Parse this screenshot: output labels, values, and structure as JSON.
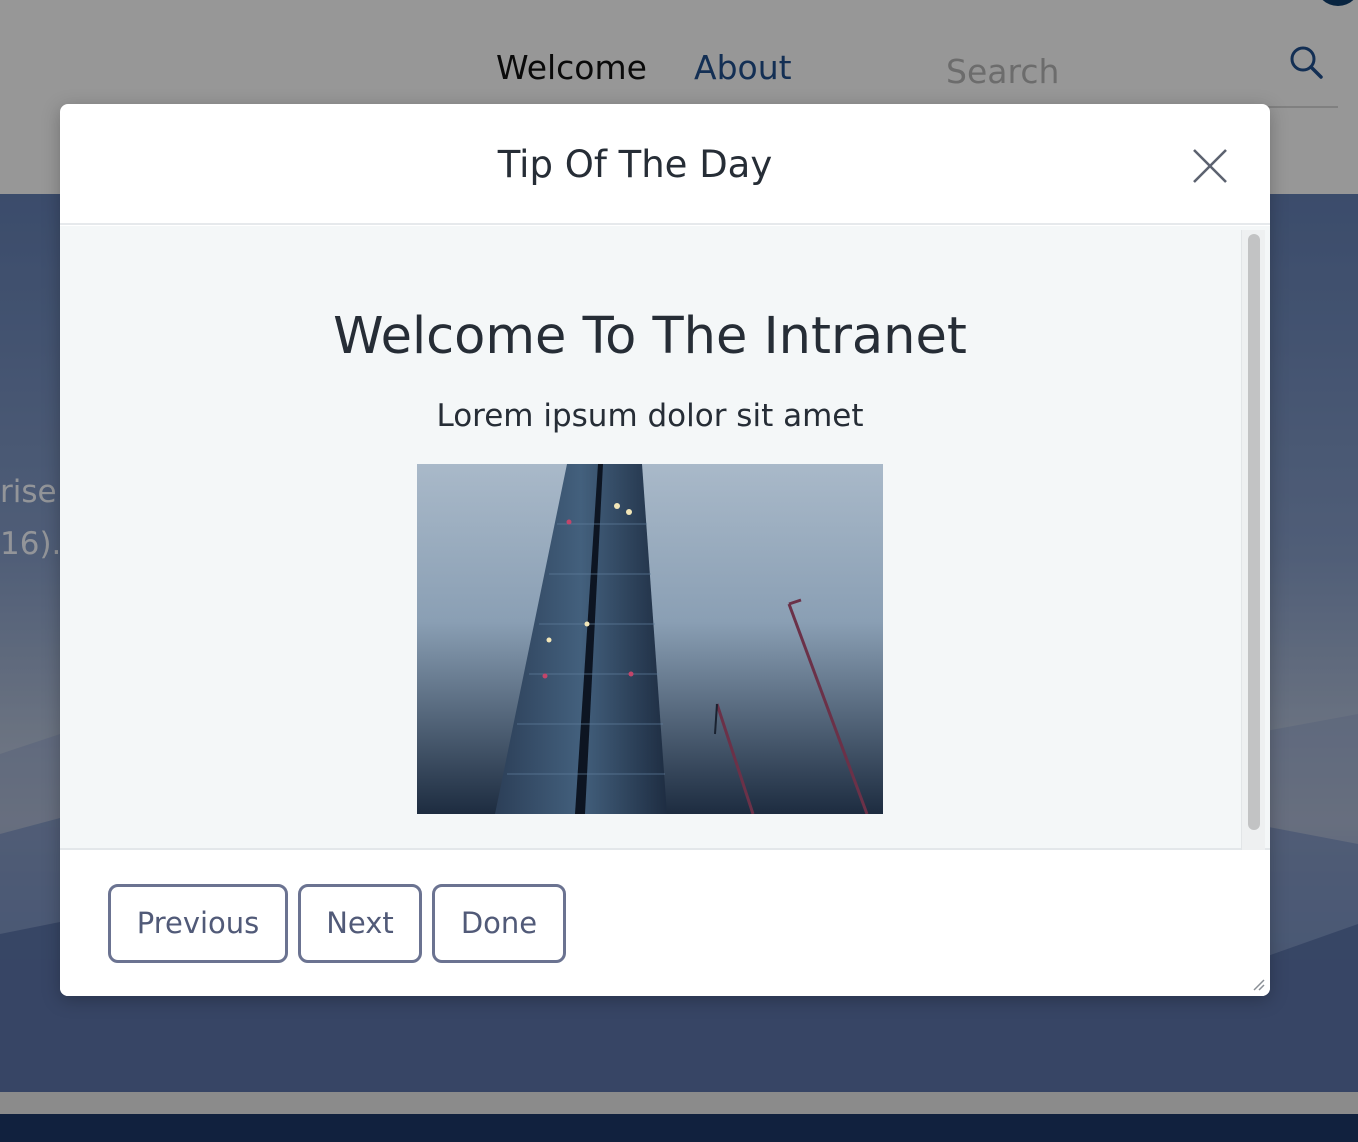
{
  "nav": {
    "welcome": "Welcome",
    "about": "About",
    "search_placeholder": "Search"
  },
  "background": {
    "text_line_1": "rise",
    "text_line_2": "16)."
  },
  "modal": {
    "title": "Tip Of The Day",
    "content_title": "Welcome To The Intranet",
    "content_subtitle": "Lorem ipsum dolor sit amet",
    "image_icon": "building-photo",
    "buttons": {
      "previous": "Previous",
      "next": "Next",
      "done": "Done"
    }
  },
  "colors": {
    "accent": "#1f4a84",
    "button_border": "#6b7391",
    "footer_bar": "#1c3561"
  }
}
